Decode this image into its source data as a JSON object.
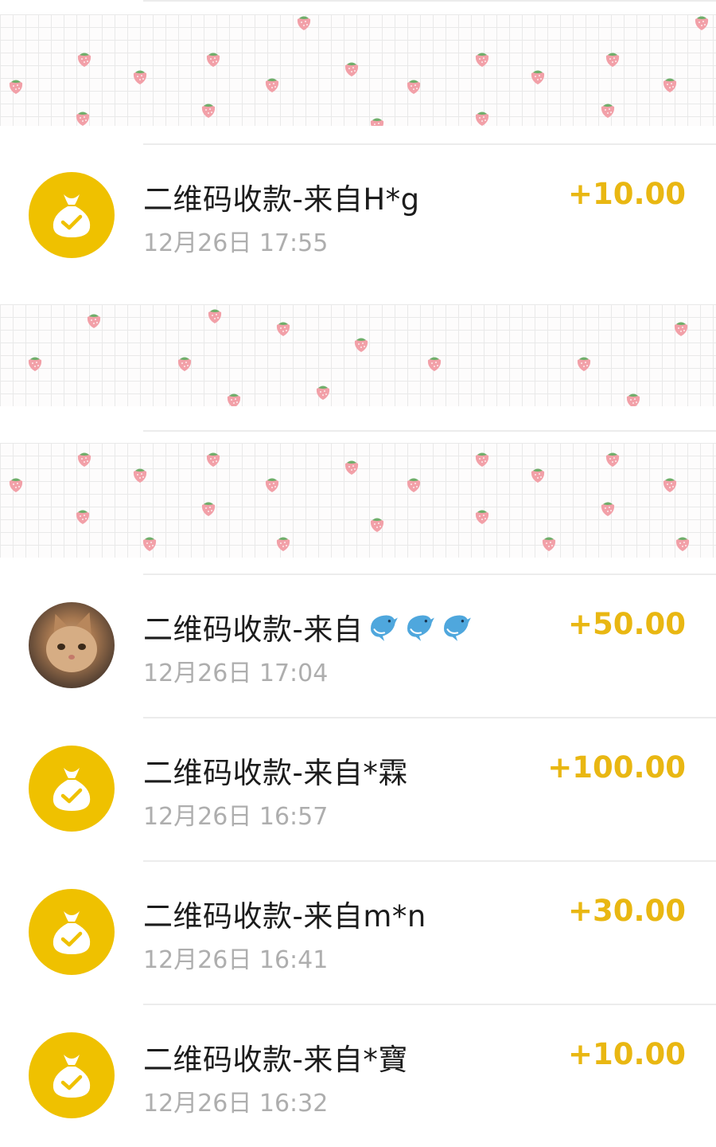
{
  "transactions": [
    {
      "title": "二维码收款-来自H*g",
      "time": "12月26日 17:55",
      "amount": "+10.00",
      "avatar": "money-bag-check-icon"
    },
    {
      "title": "二维码收款-来自",
      "title_emoji": [
        "dolphin",
        "dolphin",
        "dolphin"
      ],
      "time": "12月26日 17:04",
      "amount": "+50.00",
      "avatar": "cat-photo"
    },
    {
      "title": "二维码收款-来自*霖",
      "time": "12月26日 16:57",
      "amount": "+100.00",
      "avatar": "money-bag-check-icon"
    },
    {
      "title": "二维码收款-来自m*n",
      "time": "12月26日 16:41",
      "amount": "+30.00",
      "avatar": "money-bag-check-icon"
    },
    {
      "title": "二维码收款-来自*寶",
      "time": "12月26日 16:32",
      "amount": "+10.00",
      "avatar": "money-bag-check-icon"
    }
  ],
  "colors": {
    "amount": "#e9b712",
    "bag_icon_bg": "#efc100",
    "title": "#1c1c1c",
    "time": "#aeaeae",
    "cover_grid": "#e9e9e9",
    "strawberry": "#f2a0a8",
    "strawberry_leaf": "#6fae6a"
  }
}
